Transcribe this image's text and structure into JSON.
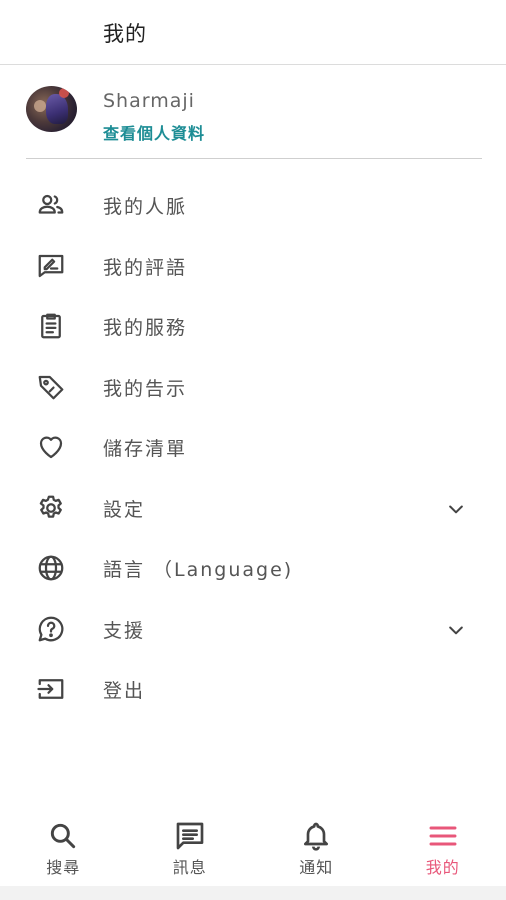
{
  "header": {
    "title": "我的"
  },
  "profile": {
    "name": "Sharmaji",
    "link_label": "查看個人資料"
  },
  "menu": {
    "items": [
      {
        "label": "我的人脈",
        "icon": "people-icon"
      },
      {
        "label": "我的評語",
        "icon": "review-icon"
      },
      {
        "label": "我的服務",
        "icon": "clipboard-icon"
      },
      {
        "label": "我的告示",
        "icon": "tag-icon"
      },
      {
        "label": "儲存清單",
        "icon": "heart-icon"
      },
      {
        "label": "設定",
        "icon": "gear-icon",
        "expandable": true
      },
      {
        "label": "語言 （Language)",
        "icon": "globe-icon"
      },
      {
        "label": "支援",
        "icon": "help-icon",
        "expandable": true
      },
      {
        "label": "登出",
        "icon": "logout-icon"
      }
    ]
  },
  "bottom_nav": {
    "items": [
      {
        "label": "搜尋",
        "icon": "search-icon"
      },
      {
        "label": "訊息",
        "icon": "message-icon"
      },
      {
        "label": "通知",
        "icon": "bell-icon"
      },
      {
        "label": "我的",
        "icon": "menu-icon",
        "active": true
      }
    ]
  },
  "colors": {
    "accent": "#1d8d95",
    "active_nav": "#e8577a",
    "icon": "#444444",
    "divider": "#cfcfcf"
  }
}
